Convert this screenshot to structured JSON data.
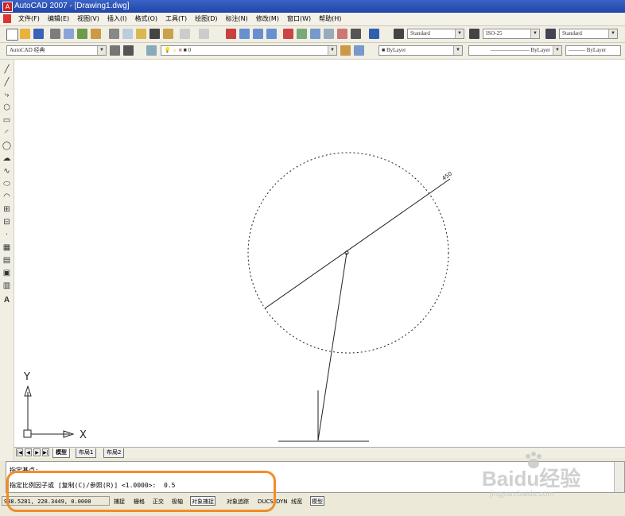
{
  "window": {
    "title": "AutoCAD 2007 - [Drawing1.dwg]"
  },
  "menu": {
    "items": [
      "文件(F)",
      "编辑(E)",
      "视图(V)",
      "插入(I)",
      "格式(O)",
      "工具(T)",
      "绘图(D)",
      "标注(N)",
      "修改(M)",
      "窗口(W)",
      "帮助(H)"
    ]
  },
  "toolbar": {
    "text_style": "Standard",
    "dim_style": "ISO-25",
    "table_style": "Standard",
    "workspace": "AutoCAD 经典",
    "layer": "0",
    "color": "ByLayer",
    "linetype": "ByLayer",
    "lineweight": "ByLayer"
  },
  "drawing": {
    "dimension_text": "450",
    "ucs_x_label": "X",
    "ucs_y_label": "Y"
  },
  "layout_tabs": [
    "模型",
    "布局1",
    "布局2"
  ],
  "command": {
    "line1": "指定基点:",
    "line2": "指定比例因子或 [复制(C)/参照(R)] <1.0000>:  0.5"
  },
  "status": {
    "coords": "988.5281, 228.3449, 0.0000",
    "toggles": [
      {
        "label": "捕捉",
        "on": false
      },
      {
        "label": "栅格",
        "on": false
      },
      {
        "label": "正交",
        "on": false
      },
      {
        "label": "极轴",
        "on": false
      },
      {
        "label": "对象捕捉",
        "on": true
      },
      {
        "label": "对象追踪",
        "on": false
      },
      {
        "label": "DUCS",
        "on": false
      },
      {
        "label": "DYN",
        "on": false
      },
      {
        "label": "线宽",
        "on": false
      },
      {
        "label": "模型",
        "on": true
      }
    ]
  },
  "watermark": {
    "brand": "Baidu经验",
    "url": "jingyan.baidu.com"
  }
}
